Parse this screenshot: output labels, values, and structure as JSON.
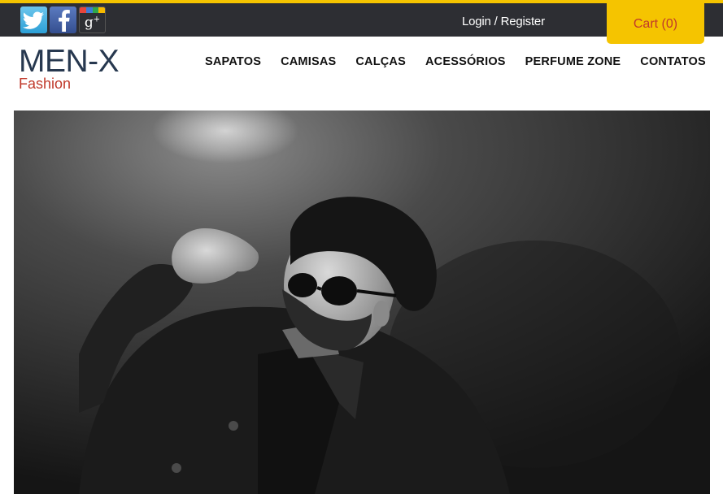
{
  "topbar": {
    "social": [
      {
        "name": "twitter-icon",
        "glyph": "🐦"
      },
      {
        "name": "facebook-icon",
        "glyph": "f"
      },
      {
        "name": "google-plus-icon",
        "glyph": "g+"
      }
    ],
    "login_label": "Login / Register",
    "cart_label": "Cart (0)"
  },
  "brand": {
    "name": "MEN-X",
    "tagline": "Fashion"
  },
  "nav": {
    "items": [
      "SAPATOS",
      "CAMISAS",
      "CALÇAS",
      "ACESSÓRIOS",
      "PERFUME ZONE",
      "CONTATOS"
    ]
  },
  "colors": {
    "accent": "#f5c400",
    "topbar": "#2d2e33",
    "brand_dark": "#27384f",
    "brand_red": "#c0392b"
  }
}
